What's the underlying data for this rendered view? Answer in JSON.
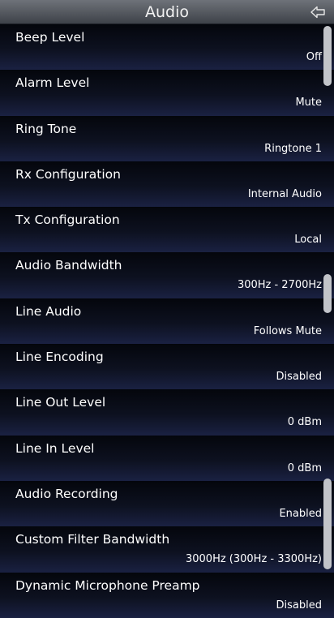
{
  "header": {
    "title": "Audio",
    "back_icon": "back-arrow-icon"
  },
  "settings": [
    {
      "label": "Beep Level",
      "value": "Off"
    },
    {
      "label": "Alarm Level",
      "value": "Mute"
    },
    {
      "label": "Ring Tone",
      "value": "Ringtone 1"
    },
    {
      "label": "Rx Configuration",
      "value": "Internal Audio"
    },
    {
      "label": "Tx Configuration",
      "value": "Local"
    },
    {
      "label": "Audio Bandwidth",
      "value": "300Hz - 2700Hz"
    },
    {
      "label": "Line Audio",
      "value": "Follows Mute"
    },
    {
      "label": "Line Encoding",
      "value": "Disabled"
    },
    {
      "label": "Line Out Level",
      "value": "0 dBm"
    },
    {
      "label": "Line In Level",
      "value": "0 dBm"
    },
    {
      "label": "Audio Recording",
      "value": "Enabled"
    },
    {
      "label": "Custom Filter Bandwidth",
      "value": "3000Hz (300Hz - 3300Hz)"
    },
    {
      "label": "Dynamic Microphone Preamp",
      "value": "Disabled"
    }
  ],
  "colors": {
    "header": "#5a5e66",
    "row_top": "#04060c",
    "row_bottom": "#1a2142",
    "scrollbar": "#c2c4c9"
  }
}
